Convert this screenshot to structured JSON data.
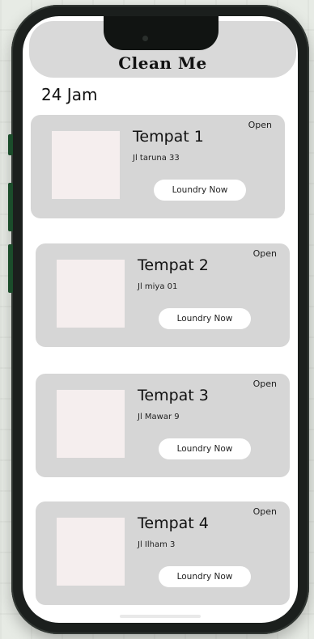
{
  "app": {
    "title": "Clean Me"
  },
  "section": {
    "title": "24 Jam"
  },
  "cards": [
    {
      "name": "Tempat 1",
      "address": "Jl taruna 33",
      "status": "Open",
      "button": "Loundry Now"
    },
    {
      "name": "Tempat 2",
      "address": "Jl miya 01",
      "status": "Open",
      "button": "Loundry Now"
    },
    {
      "name": "Tempat 3",
      "address": "Jl Mawar 9",
      "status": "Open",
      "button": "Loundry Now"
    },
    {
      "name": "Tempat 4",
      "address": "Jl Ilham 3",
      "status": "Open",
      "button": "Loundry Now"
    }
  ],
  "colors": {
    "card_bg": "#d6d6d6",
    "thumb_bg": "#f5eeee",
    "button_bg": "#ffffff",
    "phone_frame": "#1b1f1d"
  }
}
